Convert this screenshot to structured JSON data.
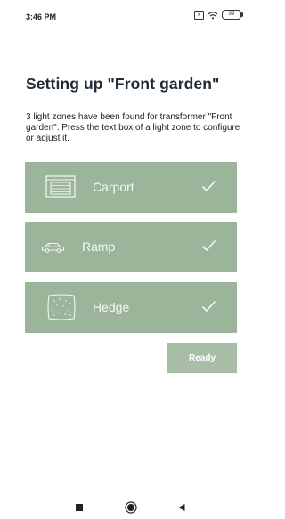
{
  "status_bar": {
    "time": "3:46 PM",
    "sim_label": "x",
    "battery_level": "99"
  },
  "header": {
    "title": "Setting up \"Front garden\""
  },
  "main": {
    "description": "3 light zones have been found for transformer \"Front garden\". Press the text box of a light zone to configure or adjust it.",
    "zones": [
      {
        "label": "Carport",
        "icon": "carport-icon",
        "status": "configured"
      },
      {
        "label": "Ramp",
        "icon": "car-icon",
        "status": "configured"
      },
      {
        "label": "Hedge",
        "icon": "hedge-icon",
        "status": "configured"
      }
    ],
    "ready_label": "Ready"
  },
  "nav_bar": {
    "buttons": [
      "recent-apps-icon",
      "home-icon",
      "back-icon"
    ]
  },
  "colors": {
    "zone_background": "#9bb49a",
    "ready_button": "#a9bea6",
    "title_text": "#1f2a33"
  }
}
